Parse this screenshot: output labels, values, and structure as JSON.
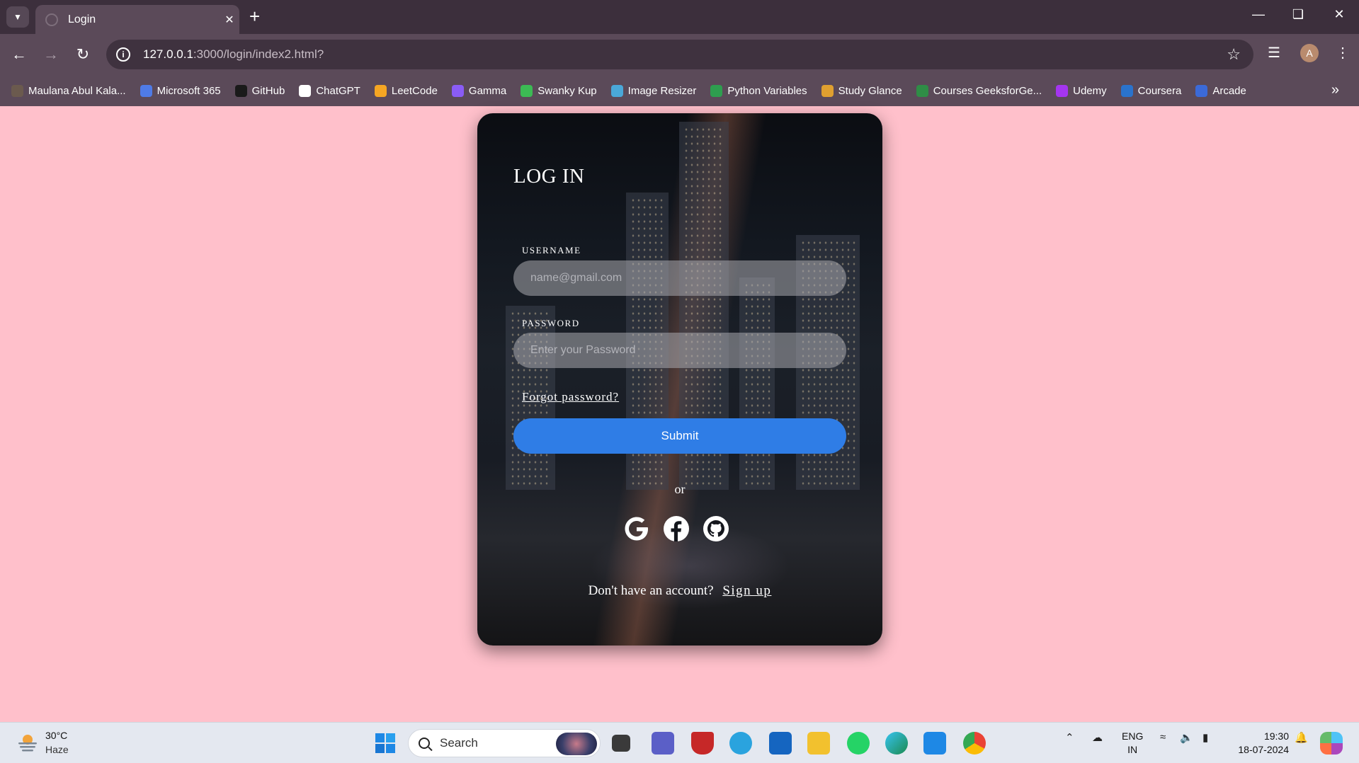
{
  "browser": {
    "tab_title": "Login",
    "url_host": "127.0.0.1",
    "url_path": ":3000/login/index2.html?",
    "avatar_letter": "A",
    "bookmarks": [
      {
        "label": "Maulana Abul Kala...",
        "color": "#6b5a4e"
      },
      {
        "label": "Microsoft 365",
        "color": "#4f7be6"
      },
      {
        "label": "GitHub",
        "color": "#1a1a1a"
      },
      {
        "label": "ChatGPT",
        "color": "#ffffff"
      },
      {
        "label": "LeetCode",
        "color": "#f5a623"
      },
      {
        "label": "Gamma",
        "color": "#8a5cf6"
      },
      {
        "label": "Swanky Kup",
        "color": "#3cba54"
      },
      {
        "label": "Image Resizer",
        "color": "#4aa8d8"
      },
      {
        "label": "Python Variables",
        "color": "#2e9e4f"
      },
      {
        "label": "Study Glance",
        "color": "#e0a030"
      },
      {
        "label": "Courses GeeksforGe...",
        "color": "#2f8d46"
      },
      {
        "label": "Udemy",
        "color": "#a435f0"
      },
      {
        "label": "Coursera",
        "color": "#2a73cc"
      },
      {
        "label": "Arcade",
        "color": "#3b6ad8"
      }
    ]
  },
  "login": {
    "title": "LOG IN",
    "username_label": "USERNAME",
    "username_placeholder": "name@gmail.com",
    "username_value": "",
    "password_label": "PASSWORD",
    "password_placeholder": "Enter your Password",
    "password_value": "",
    "forgot_label": "Forgot password?",
    "submit_label": "Submit",
    "or_text": "or",
    "social_icons": [
      "google-icon",
      "facebook-icon",
      "github-icon"
    ],
    "signup_prompt": "Don't have an account?",
    "signup_label": "Sign up",
    "accent_color": "#2f7de6",
    "page_background": "#ffc0cb"
  },
  "taskbar": {
    "temperature": "30°C",
    "weather": "Haze",
    "search_placeholder": "Search",
    "lang_line1": "ENG",
    "lang_line2": "IN",
    "time": "19:30",
    "date": "18-07-2024"
  }
}
